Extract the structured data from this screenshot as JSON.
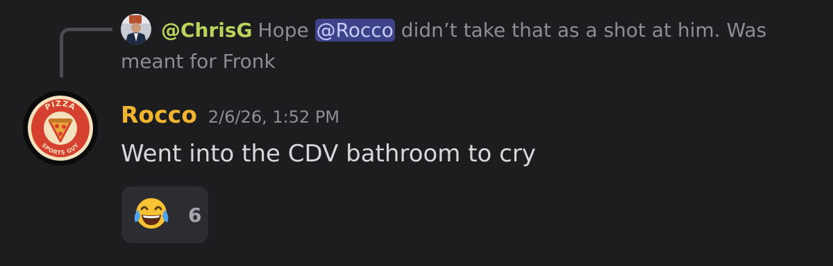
{
  "reply": {
    "author": "@ChrisG",
    "text_before": "Hope ",
    "mention": "@Rocco",
    "text_after": " didn’t take that as a shot at him. Was meant for Fronk"
  },
  "message": {
    "author": "Rocco",
    "timestamp": "2/6/26, 1:52 PM",
    "text": "Went into the CDV bathroom to cry",
    "avatar": {
      "top_text": "PIZZA",
      "bottom_text": "SPORTS GUY"
    }
  },
  "reaction": {
    "emoji": "face-with-tears-of-joy",
    "count": "6"
  },
  "colors": {
    "background": "#1d1d20",
    "reply_author": "#b9d35b",
    "author": "#f0b42e",
    "mention_bg": "#3e4389",
    "reaction_bg": "#2c2c31"
  }
}
